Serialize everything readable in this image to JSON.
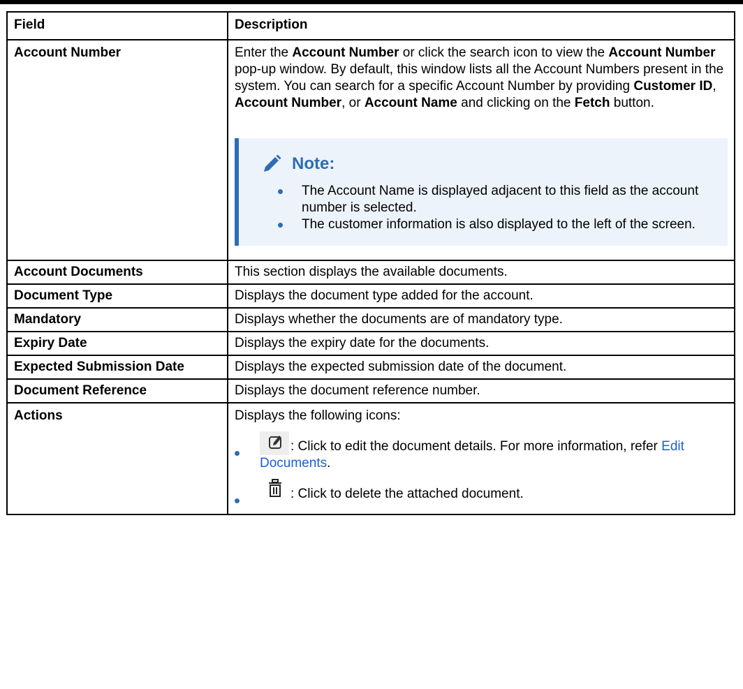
{
  "header": {
    "field": "Field",
    "description": "Description"
  },
  "account_number": {
    "field": "Account Number",
    "d1": "Enter the ",
    "d1b": "Account Number",
    "d2": " or click the search icon to view the ",
    "d2b": "Account Number",
    "d3": " pop-up window. By default, this window lists all the Account Numbers present in the system. You can search for a specific Account Number by providing ",
    "d3b": "Customer ID",
    "d4": ", ",
    "d4b": "Account Number",
    "d5": ", or ",
    "d5b": "Account Name",
    "d6": " and clicking on the ",
    "d6b": "Fetch",
    "d7": " button.",
    "note_title": "Note:",
    "note_items": [
      "The Account Name is displayed adjacent to this field as the account number is selected.",
      "The customer information is also displayed to the left of the screen."
    ]
  },
  "rows": [
    {
      "field": "Account Documents",
      "description": "This section displays the available documents."
    },
    {
      "field": "Document Type",
      "description": "Displays the document type added for the account."
    },
    {
      "field": "Mandatory",
      "description": "Displays whether the documents are of mandatory type."
    },
    {
      "field": "Expiry Date",
      "description": "Displays the expiry date for the documents."
    },
    {
      "field": "Expected Submission Date",
      "description": "Displays the expected submission date of the document."
    },
    {
      "field": "Document Reference",
      "description": "Displays the document reference number."
    }
  ],
  "actions": {
    "field": "Actions",
    "intro": "Displays the following icons:",
    "edit_text": ": Click to edit the document details. For more information, refer ",
    "edit_link": "Edit Documents",
    "edit_end": ".",
    "delete_text": ": Click to delete the attached document."
  },
  "icons": {
    "pencil": "pencil-icon",
    "edit": "edit-icon",
    "delete": "trash-icon"
  },
  "colors": {
    "accent": "#2d6db5",
    "note_bg": "#edf3fb",
    "link": "#1a5fd6"
  }
}
